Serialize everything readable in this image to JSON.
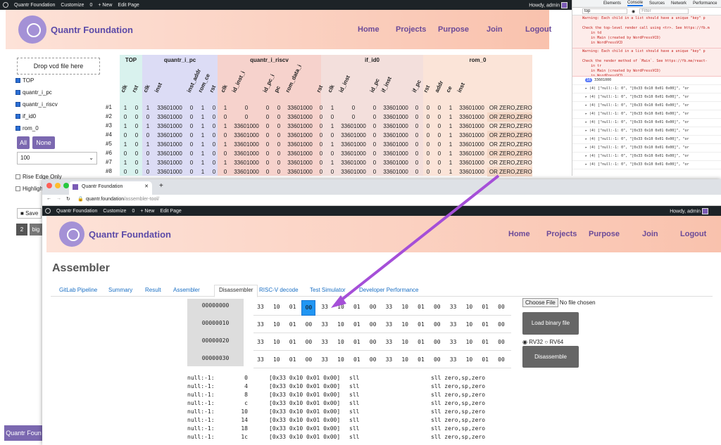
{
  "wpbar": {
    "site": "Quantr Foundation",
    "customize": "Customize",
    "comments": "0",
    "new": "+ New",
    "edit": "Edit Page",
    "howdy": "Howdy, admin"
  },
  "site": {
    "brand": "Quantr Foundation",
    "nav": [
      "Home",
      "Projects",
      "Purpose",
      "Join",
      "Logout"
    ]
  },
  "vcd": {
    "drop": "Drop vcd file here",
    "checks": [
      {
        "label": "TOP",
        "on": true
      },
      {
        "label": "quantr_i_pc",
        "on": true
      },
      {
        "label": "quantr_i_riscv",
        "on": true
      },
      {
        "label": "if_id0",
        "on": true
      },
      {
        "label": "rom_0",
        "on": true
      }
    ],
    "all": "All",
    "none": "None",
    "rows": "100",
    "rise": "Rise Edge Only",
    "highlight": "Highlight",
    "save": "Save",
    "page": "2",
    "big": "big",
    "bottom_btn": "Quantr Foun"
  },
  "table": {
    "groups": [
      {
        "name": "TOP",
        "color": "#d9f2ee"
      },
      {
        "name": "quantr_i_pc",
        "color": "#dcdcf5"
      },
      {
        "name": "quantr_i_riscv",
        "color": "#f6d2cc"
      },
      {
        "name": "if_id0",
        "color": "#f3dfdc"
      },
      {
        "name": "rom_0",
        "color": "#fbe4d8"
      }
    ],
    "columns": [
      "clk",
      "rst",
      "clk",
      "inst",
      "inst_addr",
      "rom_ce",
      "rst",
      "clk",
      "id_inst_i",
      "id_pc_i",
      "pc",
      "rom_data_i",
      "rst",
      "clk",
      "id_inst",
      "id_pc",
      "if_inst",
      "if_pc",
      "rst",
      "addr",
      "ce",
      "inst",
      ""
    ],
    "rows": [
      {
        "label": "#1",
        "cells": [
          "1",
          "0",
          "1",
          "33601000",
          "0",
          "1",
          "0",
          "1",
          "0",
          "0",
          "0",
          "33601000",
          "0",
          "1",
          "0",
          "0",
          "33601000",
          "0",
          "0",
          "0",
          "1",
          "33601000",
          "OR ZERO,ZERO,RA"
        ]
      },
      {
        "label": "#2",
        "cells": [
          "0",
          "0",
          "0",
          "33601000",
          "0",
          "1",
          "0",
          "0",
          "0",
          "0",
          "0",
          "33601000",
          "0",
          "0",
          "0",
          "0",
          "33601000",
          "0",
          "0",
          "0",
          "1",
          "33601000",
          "OR ZERO,ZERO,RA"
        ]
      },
      {
        "label": "#3",
        "cells": [
          "1",
          "0",
          "1",
          "33601000",
          "0",
          "1",
          "0",
          "1",
          "33601000",
          "0",
          "0",
          "33601000",
          "0",
          "1",
          "33601000",
          "0",
          "33601000",
          "0",
          "0",
          "0",
          "1",
          "33601000",
          "OR ZERO,ZERO,RA"
        ]
      },
      {
        "label": "#4",
        "cells": [
          "0",
          "0",
          "0",
          "33601000",
          "0",
          "1",
          "0",
          "0",
          "33601000",
          "0",
          "0",
          "33601000",
          "0",
          "0",
          "33601000",
          "0",
          "33601000",
          "0",
          "0",
          "0",
          "1",
          "33601000",
          "OR ZERO,ZERO,RA"
        ]
      },
      {
        "label": "#5",
        "cells": [
          "1",
          "0",
          "1",
          "33601000",
          "0",
          "1",
          "0",
          "1",
          "33601000",
          "0",
          "0",
          "33601000",
          "0",
          "1",
          "33601000",
          "0",
          "33601000",
          "0",
          "0",
          "0",
          "1",
          "33601000",
          "OR ZERO,ZERO,RA"
        ]
      },
      {
        "label": "#6",
        "cells": [
          "0",
          "0",
          "0",
          "33601000",
          "0",
          "1",
          "0",
          "0",
          "33601000",
          "0",
          "0",
          "33601000",
          "0",
          "0",
          "33601000",
          "0",
          "33601000",
          "0",
          "0",
          "0",
          "1",
          "33601000",
          "OR ZERO,ZERO,RA"
        ]
      },
      {
        "label": "#7",
        "cells": [
          "1",
          "0",
          "1",
          "33601000",
          "0",
          "1",
          "0",
          "1",
          "33601000",
          "0",
          "0",
          "33601000",
          "0",
          "1",
          "33601000",
          "0",
          "33601000",
          "0",
          "0",
          "0",
          "1",
          "33601000",
          "OR ZERO,ZERO,RA"
        ]
      },
      {
        "label": "#8",
        "cells": [
          "0",
          "0",
          "0",
          "33601000",
          "0",
          "1",
          "0",
          "0",
          "33601000",
          "0",
          "0",
          "33601000",
          "0",
          "0",
          "33601000",
          "0",
          "33601000",
          "0",
          "0",
          "0",
          "1",
          "33601000",
          "OR ZERO,ZERO,RA"
        ]
      }
    ]
  },
  "devtools": {
    "tabs": [
      "Elements",
      "Console",
      "Sources",
      "Network",
      "Performance"
    ],
    "context": "top",
    "filter": "Filter",
    "err1": "Warning: Each child in a list should have a unique \"key\" p\n\nCheck the top-level render call using <tr>. See https://fb.m\n    in td\n    in Main (created by WordPressVCD)\n    in WordPressVCD",
    "err2": "Warning: Each child in a list should have a unique \"key\" p\n\nCheck the render method of `Main`. See https://fb.me/react-\n    in tr\n    in Main (created by WordPressVCD)\n    in WordPressVCD",
    "count": "16",
    "value": "33601000",
    "logline": "▸ (4) [\"null:-1:        0\", \"[0x33 0x10 0x01 0x00]\", \"or",
    "logs": 10
  },
  "browser": {
    "tab": "Quantr Foundation",
    "url_host": "quantr.foundation",
    "url_path": "/assembler-tool/"
  },
  "asmpage": {
    "title": "Assembler",
    "tabs": [
      "GitLab Pipeline",
      "Summary",
      "Result",
      "Assembler",
      "Disassembler",
      "RISC-V decode",
      "Test Simulator",
      "Developer Performance"
    ],
    "active_tab": "Disassembler",
    "addresses": [
      "00000000",
      "00000010",
      "00000020",
      "00000030"
    ],
    "hex": [
      "33",
      "10",
      "01",
      "00",
      "33",
      "10",
      "01",
      "00",
      "33",
      "10",
      "01",
      "00",
      "33",
      "10",
      "01",
      "00"
    ],
    "selected_byte": "00",
    "choose_file": "Choose File",
    "no_file": "No file chosen",
    "load": "Load binary file",
    "rv32": "RV32",
    "rv64": "RV64",
    "disassemble": "Disassemble",
    "lines": [
      [
        "null:-1:",
        "0",
        "[0x33 0x10 0x01 0x00]",
        "sll",
        "sll zero,sp,zero"
      ],
      [
        "null:-1:",
        "4",
        "[0x33 0x10 0x01 0x00]",
        "sll",
        "sll zero,sp,zero"
      ],
      [
        "null:-1:",
        "8",
        "[0x33 0x10 0x01 0x00]",
        "sll",
        "sll zero,sp,zero"
      ],
      [
        "null:-1:",
        "c",
        "[0x33 0x10 0x01 0x00]",
        "sll",
        "sll zero,sp,zero"
      ],
      [
        "null:-1:",
        "10",
        "[0x33 0x10 0x01 0x00]",
        "sll",
        "sll zero,sp,zero"
      ],
      [
        "null:-1:",
        "14",
        "[0x33 0x10 0x01 0x00]",
        "sll",
        "sll zero,sp,zero"
      ],
      [
        "null:-1:",
        "18",
        "[0x33 0x10 0x01 0x00]",
        "sll",
        "sll zero,sp,zero"
      ],
      [
        "null:-1:",
        "1c",
        "[0x33 0x10 0x01 0x00]",
        "sll",
        "sll zero,sp,zero"
      ]
    ]
  },
  "colors": {
    "purple": "#7b5bb5",
    "arrow": "#a54fd8",
    "highlight": "#2196f3"
  }
}
